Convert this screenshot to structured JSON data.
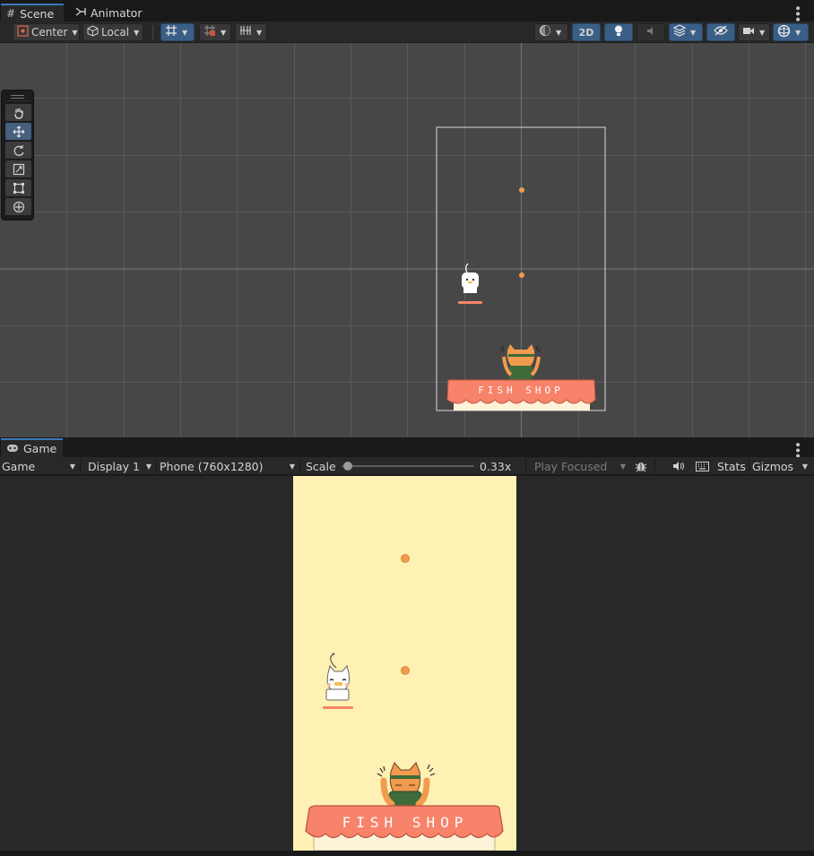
{
  "scene_panel": {
    "tabs": [
      {
        "label": "Scene",
        "icon": "hash-grid-icon",
        "active": true
      },
      {
        "label": "Animator",
        "icon": "animator-icon",
        "active": false
      }
    ],
    "toolbar": {
      "pivot_label": "Center",
      "space_label": "Local",
      "mode_2d_label": "2D",
      "icons": [
        "shading-mode-icon",
        "lighting-icon",
        "audio-icon",
        "effects-icon",
        "visibility-icon",
        "camera-icon",
        "gizmos-icon"
      ]
    },
    "tools": [
      {
        "name": "hand-tool",
        "active": false
      },
      {
        "name": "move-tool",
        "active": true
      },
      {
        "name": "rotate-tool",
        "active": false
      },
      {
        "name": "scale-tool",
        "active": false
      },
      {
        "name": "rect-tool",
        "active": false
      },
      {
        "name": "transform-tool",
        "active": false
      }
    ],
    "awning_text": "FISH SHOP"
  },
  "game_panel": {
    "tab_label": "Game",
    "tab_icon": "gamepad-icon",
    "view_mode": "Game",
    "display": "Display 1",
    "resolution": "Phone (760x1280)",
    "scale_label": "Scale",
    "scale_value": "0.33x",
    "scale_fraction": 0.05,
    "play_mode": "Play Focused",
    "stats_label": "Stats",
    "gizmos_label": "Gizmos",
    "awning_text": "FISH SHOP"
  },
  "colors": {
    "game_background": "#fff0b3",
    "awning": "#f6836a",
    "orange_dot": "#f19b4f",
    "accent_blue": "#3a79bb"
  }
}
